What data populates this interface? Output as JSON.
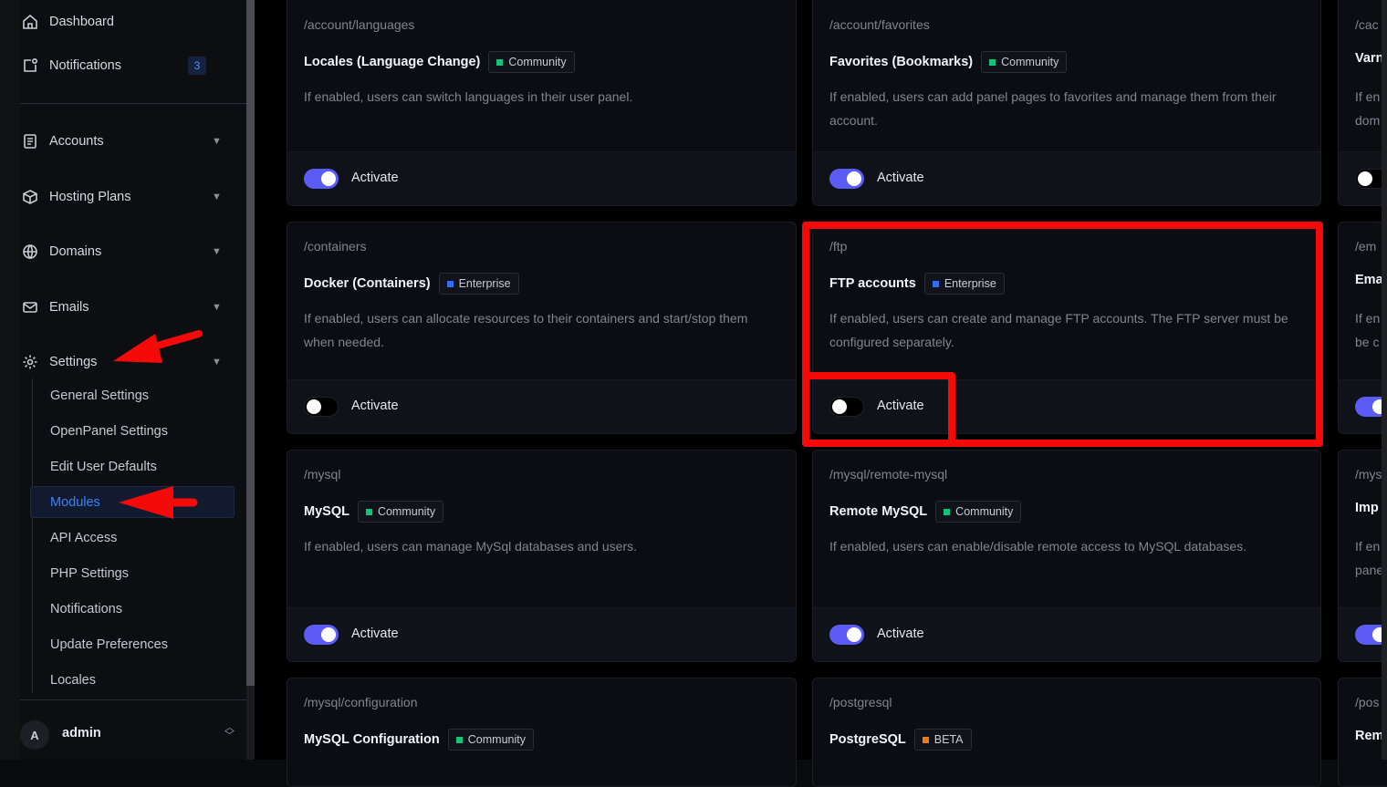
{
  "sidebar": {
    "top": [
      {
        "label": "Dashboard",
        "icon": "home-icon"
      },
      {
        "label": "Notifications",
        "icon": "notification-icon",
        "badge": "3"
      }
    ],
    "groups": [
      {
        "label": "Accounts",
        "icon": "accounts-icon"
      },
      {
        "label": "Hosting Plans",
        "icon": "hosting-plans-icon"
      },
      {
        "label": "Domains",
        "icon": "globe-icon"
      },
      {
        "label": "Emails",
        "icon": "mail-icon"
      },
      {
        "label": "Settings",
        "icon": "gear-icon"
      }
    ],
    "settings_items": [
      {
        "label": "General Settings"
      },
      {
        "label": "OpenPanel Settings"
      },
      {
        "label": "Edit User Defaults"
      },
      {
        "label": "Modules",
        "active": true
      },
      {
        "label": "API Access"
      },
      {
        "label": "PHP Settings"
      },
      {
        "label": "Notifications"
      },
      {
        "label": "Update Preferences"
      },
      {
        "label": "Locales"
      }
    ],
    "user": {
      "initial": "A",
      "name": "admin"
    }
  },
  "modules": [
    {
      "path": "/account/languages",
      "title": "Locales (Language Change)",
      "tag": "Community",
      "desc": "If enabled, users can switch languages in their user panel.",
      "active": true,
      "action": "Activate"
    },
    {
      "path": "/account/favorites",
      "title": "Favorites (Bookmarks)",
      "tag": "Community",
      "desc": "If enabled, users can add panel pages to favorites and manage them from their account.",
      "active": true,
      "action": "Activate"
    },
    {
      "path": "/cac",
      "title": "Varn",
      "desc": "If en dom",
      "active": false
    },
    {
      "path": "/containers",
      "title": "Docker (Containers)",
      "tag": "Enterprise",
      "desc": "If enabled, users can allocate resources to their containers and start/stop them when needed.",
      "active": false,
      "action": "Activate"
    },
    {
      "path": "/ftp",
      "title": "FTP accounts",
      "tag": "Enterprise",
      "desc": "If enabled, users can create and manage FTP accounts. The FTP server must be configured separately.",
      "active": false,
      "action": "Activate"
    },
    {
      "path": "/em",
      "title": "Ema",
      "desc": "If en be c",
      "active": true
    },
    {
      "path": "/mysql",
      "title": "MySQL",
      "tag": "Community",
      "desc": "If enabled, users can manage MySql databases and users.",
      "active": true,
      "action": "Activate"
    },
    {
      "path": "/mysql/remote-mysql",
      "title": "Remote MySQL",
      "tag": "Community",
      "desc": "If enabled, users can enable/disable remote access to MySQL databases.",
      "active": true,
      "action": "Activate"
    },
    {
      "path": "/mys",
      "title": "Imp",
      "desc": "If en pane",
      "active": true
    },
    {
      "path": "/mysql/configuration",
      "title": "MySQL Configuration",
      "tag": "Community"
    },
    {
      "path": "/postgresql",
      "title": "PostgreSQL",
      "tag": "BETA"
    },
    {
      "path": "/pos",
      "title": "Rem"
    }
  ],
  "colors": {
    "community": "#10c47a",
    "enterprise": "#2f6df6",
    "beta": "#f07a1a",
    "toggle_on": "#5b5bf5",
    "highlight": "#f50a0a",
    "active_link": "#3b82f6"
  }
}
